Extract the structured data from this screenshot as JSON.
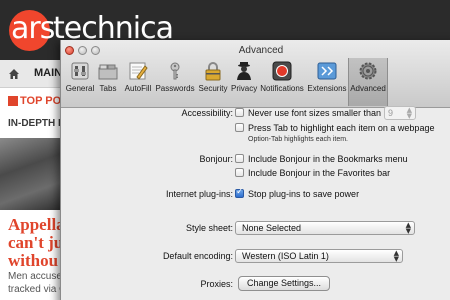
{
  "website": {
    "logo": {
      "part1": "ars",
      "part2": "technica"
    },
    "nav": {
      "main_label": "MAIN"
    },
    "top_stories_label": "TOP POS",
    "section_label": "IN-DEPTH REP",
    "headline": "Appella\ncan't ju\nwithou",
    "blurb": "Men accused\ntracked via G"
  },
  "window": {
    "title": "Advanced",
    "toolbar": [
      {
        "label": "General",
        "icon": "general-switch-icon"
      },
      {
        "label": "Tabs",
        "icon": "tabs-icon"
      },
      {
        "label": "AutoFill",
        "icon": "autofill-pencil-icon"
      },
      {
        "label": "Passwords",
        "icon": "key-icon"
      },
      {
        "label": "Security",
        "icon": "padlock-icon"
      },
      {
        "label": "Privacy",
        "icon": "privacy-silhouette-icon"
      },
      {
        "label": "Notifications",
        "icon": "notifications-icon"
      },
      {
        "label": "Extensions",
        "icon": "puzzle-icon"
      },
      {
        "label": "Advanced",
        "icon": "gear-icon"
      }
    ],
    "selected_tab": "Advanced"
  },
  "content": {
    "accessibility": {
      "label": "Accessibility:",
      "min_font_option": "Never use font sizes smaller than",
      "min_font_value": "9",
      "min_font_checked": false,
      "tab_option": "Press Tab to highlight each item on a webpage",
      "tab_checked": false,
      "tab_hint": "Option-Tab highlights each item."
    },
    "bonjour": {
      "label": "Bonjour:",
      "bookmarks_option": "Include Bonjour in the Bookmarks menu",
      "bookmarks_checked": false,
      "favorites_option": "Include Bonjour in the Favorites bar",
      "favorites_checked": false
    },
    "plugins": {
      "label": "Internet plug-ins:",
      "option": "Stop plug-ins to save power",
      "checked": true
    },
    "style_sheet": {
      "label": "Style sheet:",
      "value": "None Selected"
    },
    "encoding": {
      "label": "Default encoding:",
      "value": "Western (ISO Latin 1)"
    },
    "proxies": {
      "label": "Proxies:",
      "button": "Change Settings..."
    }
  },
  "colors": {
    "brand_orange": "#f0462d",
    "window_bg": "#ececec",
    "checkbox_checked": "#2f6fcf"
  }
}
